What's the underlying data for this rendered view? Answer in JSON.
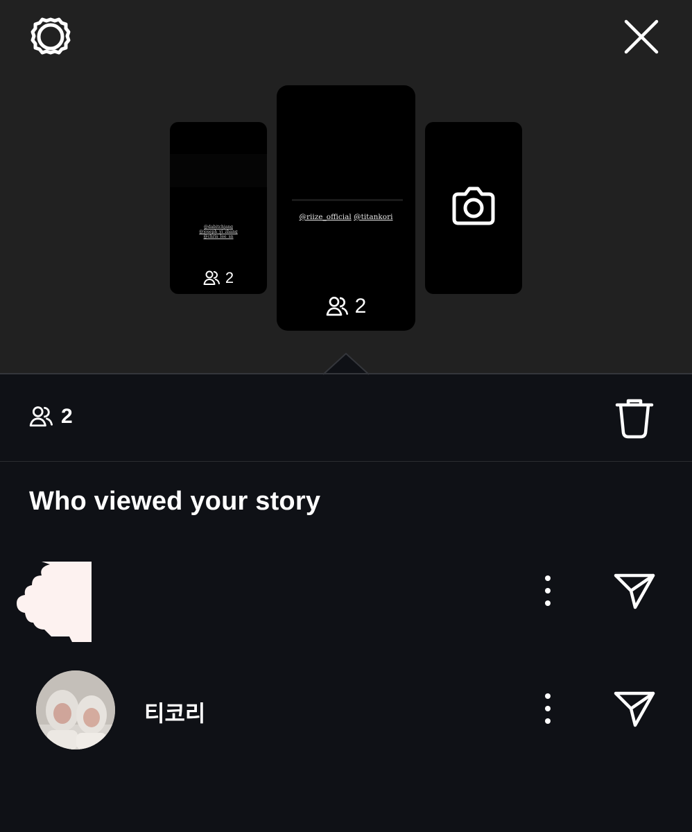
{
  "header": {
    "settings_icon": "gear-icon",
    "close_icon": "close-icon"
  },
  "stories": [
    {
      "mentions": [
        "@dabitchjang",
        "@joseph_yi_zhang",
        "@chris_lee_sn"
      ],
      "viewer_count": "2"
    },
    {
      "mentions": [
        "@riize_official",
        "@titankori"
      ],
      "viewer_count": "2"
    },
    {
      "icon": "camera-icon"
    }
  ],
  "stats": {
    "viewer_count": "2",
    "delete_icon": "trash-icon"
  },
  "viewers_section": {
    "title": "Who viewed your story",
    "viewers": [
      {
        "username": "",
        "more_icon": "more-vertical-icon",
        "send_icon": "send-icon"
      },
      {
        "username": "티코리",
        "more_icon": "more-vertical-icon",
        "send_icon": "send-icon"
      }
    ]
  },
  "colors": {
    "top_background": "#212121",
    "page_background": "#0f1116",
    "text": "#ffffff",
    "divider": "#2b2d31"
  }
}
